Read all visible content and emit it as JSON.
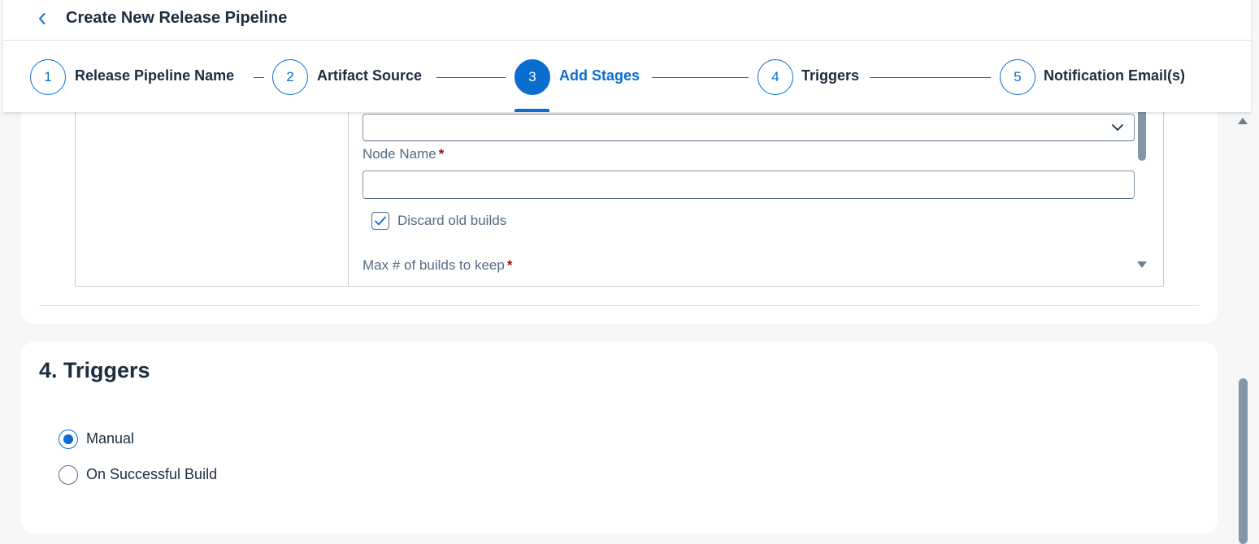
{
  "header": {
    "title": "Create New Release Pipeline"
  },
  "wizard": {
    "steps": [
      {
        "number": "1",
        "label": "Release Pipeline Name"
      },
      {
        "number": "2",
        "label": "Artifact Source"
      },
      {
        "number": "3",
        "label": "Add Stages"
      },
      {
        "number": "4",
        "label": "Triggers"
      },
      {
        "number": "5",
        "label": "Notification Email(s)"
      }
    ],
    "active_step": 3
  },
  "stage_form": {
    "select_value": "",
    "node_name": {
      "label": "Node Name",
      "required_mark": "*",
      "value": ""
    },
    "discard_old_builds": {
      "label": "Discard old builds",
      "checked": true
    },
    "max_builds": {
      "label": "Max # of builds to keep",
      "required_mark": "*"
    }
  },
  "triggers": {
    "title": "4. Triggers",
    "options": [
      {
        "label": "Manual",
        "selected": true
      },
      {
        "label": "On Successful Build",
        "selected": false
      }
    ]
  },
  "colors": {
    "accent": "#0a6ed1",
    "required": "#aa0808",
    "text": "#1d2d3e",
    "muted_text": "#556b82"
  }
}
